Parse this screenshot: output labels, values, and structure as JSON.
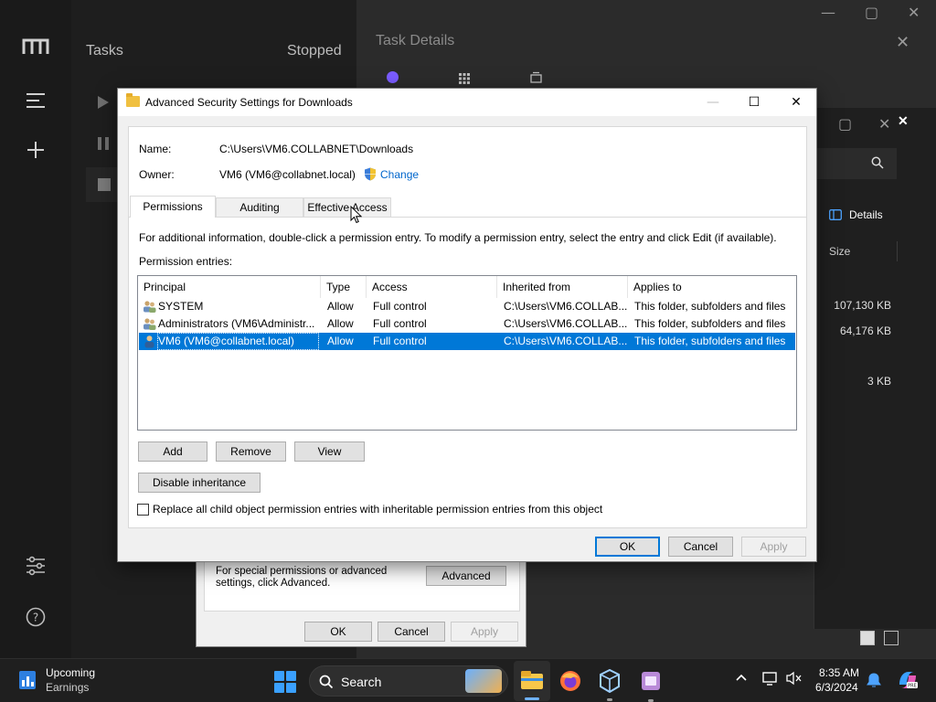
{
  "background_app": {
    "tasks_title": "Tasks",
    "stopped_title": "Stopped",
    "task_details_title": "Task Details",
    "details_label": "Details",
    "size_header": "Size",
    "sizes": [
      "107,130 KB",
      "64,176 KB",
      "3 KB"
    ]
  },
  "properties_dialog": {
    "hint_text": "For special permissions or advanced settings, click Advanced.",
    "advanced_label": "Advanced",
    "ok_label": "OK",
    "cancel_label": "Cancel",
    "apply_label": "Apply"
  },
  "dialog": {
    "title": "Advanced Security Settings for Downloads",
    "name_label": "Name:",
    "name_value": "C:\\Users\\VM6.COLLABNET\\Downloads",
    "owner_label": "Owner:",
    "owner_value": "VM6 (VM6@collabnet.local)",
    "change_label": "Change",
    "tabs": [
      "Permissions",
      "Auditing",
      "Effective Access"
    ],
    "info_text": "For additional information, double-click a permission entry. To modify a permission entry, select the entry and click Edit (if available).",
    "entries_label": "Permission entries:",
    "columns": [
      "Principal",
      "Type",
      "Access",
      "Inherited from",
      "Applies to"
    ],
    "rows": [
      {
        "principal": "SYSTEM",
        "type": "Allow",
        "access": "Full control",
        "inherited": "C:\\Users\\VM6.COLLAB...",
        "applies": "This folder, subfolders and files"
      },
      {
        "principal": "Administrators (VM6\\Administr...",
        "type": "Allow",
        "access": "Full control",
        "inherited": "C:\\Users\\VM6.COLLAB...",
        "applies": "This folder, subfolders and files"
      },
      {
        "principal": "VM6 (VM6@collabnet.local)",
        "type": "Allow",
        "access": "Full control",
        "inherited": "C:\\Users\\VM6.COLLAB...",
        "applies": "This folder, subfolders and files"
      }
    ],
    "add_label": "Add",
    "remove_label": "Remove",
    "view_label": "View",
    "disable_inheritance_label": "Disable inheritance",
    "replace_checkbox_label": "Replace all child object permission entries with inheritable permission entries from this object",
    "ok_label": "OK",
    "cancel_label": "Cancel",
    "apply_label": "Apply"
  },
  "taskbar": {
    "widget_title": "Upcoming",
    "widget_subtitle": "Earnings",
    "search_label": "Search",
    "time": "8:35 AM",
    "date": "6/3/2024"
  },
  "colors": {
    "selection": "#0078d7",
    "link": "#0066cc"
  }
}
